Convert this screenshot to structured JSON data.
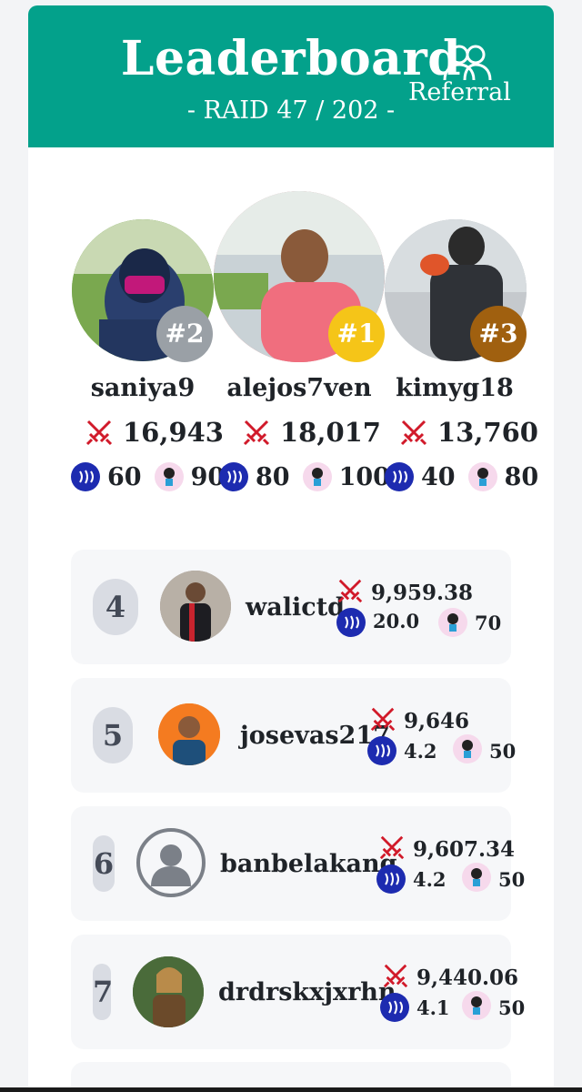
{
  "header": {
    "title": "Leaderboard",
    "subtitle": "- RAID 47 / 202 -",
    "referral_label": "Referral",
    "accent_color": "#03a18b"
  },
  "podium": [
    {
      "rank_label": "#2",
      "name": "saniya9",
      "score": "16,943",
      "steem": "60",
      "char": "90",
      "badge_color": "#9aa0a6"
    },
    {
      "rank_label": "#1",
      "name": "alejos7ven",
      "score": "18,017",
      "steem": "80",
      "char": "100",
      "badge_color": "#f5c518"
    },
    {
      "rank_label": "#3",
      "name": "kimyg18",
      "score": "13,760",
      "steem": "40",
      "char": "80",
      "badge_color": "#a0600f"
    }
  ],
  "rows": [
    {
      "rank": "4",
      "name": "walictd",
      "score": "9,959.38",
      "steem": "20.0",
      "char": "70"
    },
    {
      "rank": "5",
      "name": "josevas217",
      "score": "9,646",
      "steem": "4.2",
      "char": "50"
    },
    {
      "rank": "6",
      "name": "banbelakang",
      "score": "9,607.34",
      "steem": "4.2",
      "char": "50"
    },
    {
      "rank": "7",
      "name": "drdrskxjxrhn",
      "score": "9,440.06",
      "steem": "4.1",
      "char": "50"
    }
  ],
  "icons": {
    "score": "crossed-swords-icon",
    "steem": "steem-token-icon",
    "char": "character-token-icon",
    "referral": "users-icon"
  }
}
